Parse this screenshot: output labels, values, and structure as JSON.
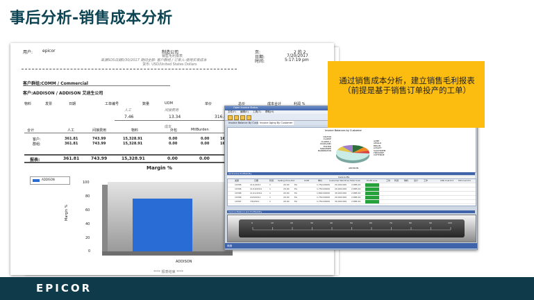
{
  "slide": {
    "title": "事后分析-销售成本分析",
    "logo": "EPICOR",
    "callout": "通过销售成本分析，建立销售毛利报表（前提是基于销售订单投产的工单）"
  },
  "report": {
    "user_label": "用户:",
    "user_value": "epicor",
    "company": "制造公司",
    "report_title": "销售毛利报表",
    "subtitle": "来源SOS日期0/30/2017  期间全部: 客户群组 / 订单人-使用实单成本",
    "currency": "货币: USD/United States Dollars",
    "page_label": "页:",
    "page_value": "2 的 2",
    "date_label": "日期:",
    "date_value": "7/20/2017",
    "time_label": "时间:",
    "time_value": "5:17:19 pm",
    "group": "客户群组:COMM / Commercial",
    "customer": "客户:ADDISON / ADDISON 艾迪生公司",
    "columns": [
      "物料",
      "发票",
      "日期",
      "工单编号",
      "数量",
      "UOM",
      "单价",
      "总价",
      "成本合计",
      "利润 %"
    ],
    "sub_headers": [
      "人工",
      "间接费用"
    ],
    "detail_values": [
      "7.46",
      "13.34",
      "316.06"
    ],
    "cost_label": "成本",
    "summary_headers": [
      "合计",
      "人工",
      "间接费用",
      "物料",
      "外包",
      "MtlBurden"
    ],
    "summary_rows": [
      {
        "label": "客户:",
        "values": [
          "361.81",
          "743.99",
          "15,328.91",
          "0.00",
          "0.00",
          "16"
        ]
      },
      {
        "label": "群组:",
        "values": [
          "361.81",
          "743.99",
          "15,328.91",
          "0.00",
          "0.00",
          "16"
        ]
      }
    ],
    "report_total": {
      "label": "报表:",
      "values": [
        "361.81",
        "743.99",
        "15,328.91",
        "0.00",
        "0.00"
      ]
    },
    "end_text": "**** 报表结束 ****"
  },
  "chart_data": {
    "type": "bar",
    "title": "Margin %",
    "ylabel": "Margin %",
    "xlabel": "",
    "categories": [
      "ADDISON"
    ],
    "series": [
      {
        "name": "ADDISON",
        "values": [
          76
        ]
      }
    ],
    "ylim": [
      0,
      100
    ],
    "yticks": [
      "0",
      "20",
      "40",
      "60",
      "80",
      "100"
    ],
    "legend": "top-left",
    "colors": {
      "bar": "#2a6cd6"
    }
  },
  "app": {
    "title": "Open Invoice Status",
    "menu": [
      "文件(F)",
      "编辑(E)",
      "工具(T)",
      "帮助(H)"
    ],
    "tabs": [
      "Invoice Balance By Customer",
      "Invoice Aging By Customer"
    ],
    "pie_title": "Invoice Balances by Customer",
    "pie_labels_left": [
      "DALTON",
      "CLARKE",
      "CLARKE_1",
      "DOLELAND",
      "FOSTER",
      "MAPLEWEE",
      "BARRINGTON"
    ],
    "pie_labels_right": [
      "ACME",
      "APOLLO",
      "BRAUN",
      "LOYALTY",
      "SALSTROEM",
      "TRIDOORP",
      "CUTTHROE"
    ],
    "pie_bottom_label": "ADDISON",
    "grid_panel": "All Invoice Profitability",
    "grid_caption": "Invoice Pts",
    "grid_headers": [
      "发票",
      "日期",
      "利润",
      "Selling Price Ext",
      "UOM",
      "单价",
      "Customer Net Price",
      "Total Cost",
      "Profit Loss",
      "工时",
      "利润",
      "物料",
      "合计",
      "工作",
      "LBR Cost Pct",
      "Mtl Cost Pct"
    ],
    "grid_rows": [
      [
        "10396",
        "11/1/2011",
        "1",
        "20.00",
        "EA",
        "1,750.00000",
        "20,000.000",
        "2,885.00"
      ],
      [
        "10396",
        "11/10/2011",
        "1",
        "20.00",
        "EA",
        "1,750.00000",
        "20,000.000",
        "2,885.00"
      ],
      [
        "10396",
        "11/11/2011",
        "1",
        "20.00",
        "EA",
        "1,800.00000",
        "30,000.000",
        "2,885.00"
      ],
      [
        "10396",
        "2/20/2011",
        "1",
        "20.00",
        "EA",
        "1,750.00000",
        "20,000.000",
        "2,885.00"
      ],
      [
        "10397",
        "7/6/2011",
        "1",
        "20.00",
        "EA",
        "1,750.00000",
        "30,000.000",
        "2,885.00"
      ]
    ],
    "gauge_panel": "Invoice Balance and Profitability",
    "gauge_ticks": [
      "0",
      "10",
      "20",
      "30",
      "40",
      "50",
      "60",
      "70",
      "80",
      "90",
      "100"
    ],
    "status": "就绪"
  }
}
